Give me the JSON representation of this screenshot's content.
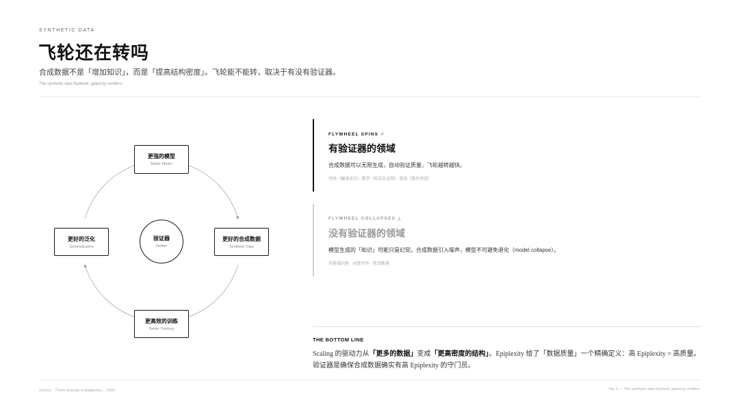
{
  "header": {
    "eyebrow": "SYNTHETIC DATA",
    "title": "飞轮还在转吗",
    "subtitle": "合成数据不是「增加知识」，而是「提高结构密度」。飞轮能不能转，取决于有没有验证器。",
    "subtitle_en": "The synthetic data flywheel, gated by verifiers"
  },
  "diagram": {
    "top": {
      "zh": "更强的模型",
      "en": "Better Model"
    },
    "right": {
      "zh": "更好的合成数据",
      "en": "Synthetic Data"
    },
    "bottom": {
      "zh": "更高效的训练",
      "en": "Better Training"
    },
    "left": {
      "zh": "更好的泛化",
      "en": "Generalization"
    },
    "center": {
      "zh": "验证器",
      "en": "Verifier"
    }
  },
  "cards": {
    "spins": {
      "label": "FLYWHEEL SPINS ✓",
      "heading": "有验证器的领域",
      "desc": "合成数据可以无限生成，自动验证质量，飞轮越转越快。",
      "tags": "代码（编译运行）· 数学（形式化证明）· 游戏（胜负判定）"
    },
    "collapses": {
      "label": "FLYWHEEL COLLAPSES ⟂",
      "heading": "没有验证器的领域",
      "desc": "模型生成的「知识」可能只是幻觉。合成数据引入噪声，模型不可避免退化（model collapse）。",
      "tags": "开放域问答 · 创意写作 · 常识推理"
    }
  },
  "bottom_line": {
    "label": "THE BOTTOM LINE",
    "p1": "Scaling 的驱动力从",
    "b1": "「更多的数据」",
    "p2": "变成",
    "b2": "「更高密度的结构」",
    "p3": "。Epiplexity 给了「数据质量」一个精确定义：高 Epiplexity = 高质量。验证器是确保合成数据确实有高 Epiplexity 的守门员。"
  },
  "footer": {
    "source": "Source: 「From Entropy to Epiplexity」, 2026",
    "fig": "Fig. 5 — The synthetic data flywheel, gated by verifiers"
  },
  "colors": {
    "ink": "#111111",
    "muted": "#999999",
    "rule": "#e8e8e8",
    "arrow": "#999999"
  }
}
